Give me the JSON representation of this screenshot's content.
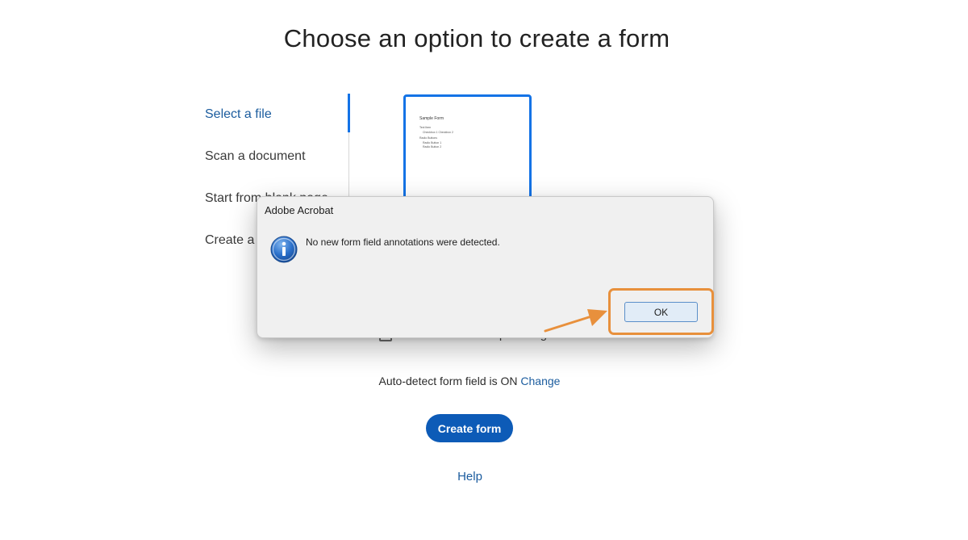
{
  "page": {
    "title": "Choose an option to create a form"
  },
  "nav": {
    "items": [
      {
        "label": "Select a file"
      },
      {
        "label": "Scan a document"
      },
      {
        "label": "Start from blank page"
      },
      {
        "label": "Create a W"
      }
    ]
  },
  "thumbnail": {
    "title": "Sample Form",
    "lines": [
      "Text Item",
      "Checkbox 1      Checkbox 2",
      "Radio Buttons",
      "Radio Button 1",
      "Radio Button 2"
    ]
  },
  "signature_option": {
    "label": "This document requires signatures",
    "checked": false
  },
  "autodetect": {
    "text": "Auto-detect form field is ON",
    "link": "Change"
  },
  "create_button": {
    "label": "Create form"
  },
  "help": {
    "label": "Help"
  },
  "dialog": {
    "title": "Adobe Acrobat",
    "message": "No new form field annotations were detected.",
    "ok_label": "OK",
    "icon": "info-icon"
  },
  "colors": {
    "accent_blue": "#1473e6",
    "button_blue": "#0d5bb7",
    "link_blue": "#1b5c9e",
    "annotation_orange": "#e8903c"
  }
}
